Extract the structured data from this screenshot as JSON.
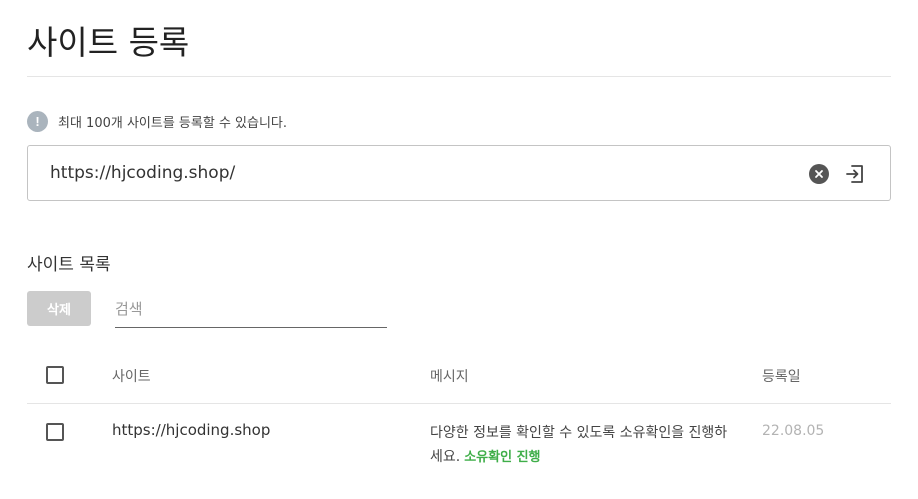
{
  "page": {
    "title": "사이트 등록"
  },
  "info": {
    "icon": "info-icon",
    "icon_glyph": "!",
    "text": "최대 100개 사이트를 등록할 수 있습니다."
  },
  "url_field": {
    "value": "https://hjcoding.shop/",
    "clear_icon": "clear-icon",
    "submit_icon": "enter-icon"
  },
  "list": {
    "section_title": "사이트 목록",
    "delete_label": "삭제",
    "search_placeholder": "검색",
    "headers": {
      "site": "사이트",
      "message": "메시지",
      "date": "등록일"
    },
    "rows": [
      {
        "site": "https://hjcoding.shop",
        "message": "다양한 정보를 확인할 수 있도록 소유확인을 진행하세요.",
        "verify_link": "소유확인 진행",
        "date": "22.08.05",
        "checked": false
      }
    ]
  },
  "colors": {
    "accent_green": "#3fae49",
    "disabled_button": "#cccccc",
    "info_icon": "#aab4bd"
  }
}
